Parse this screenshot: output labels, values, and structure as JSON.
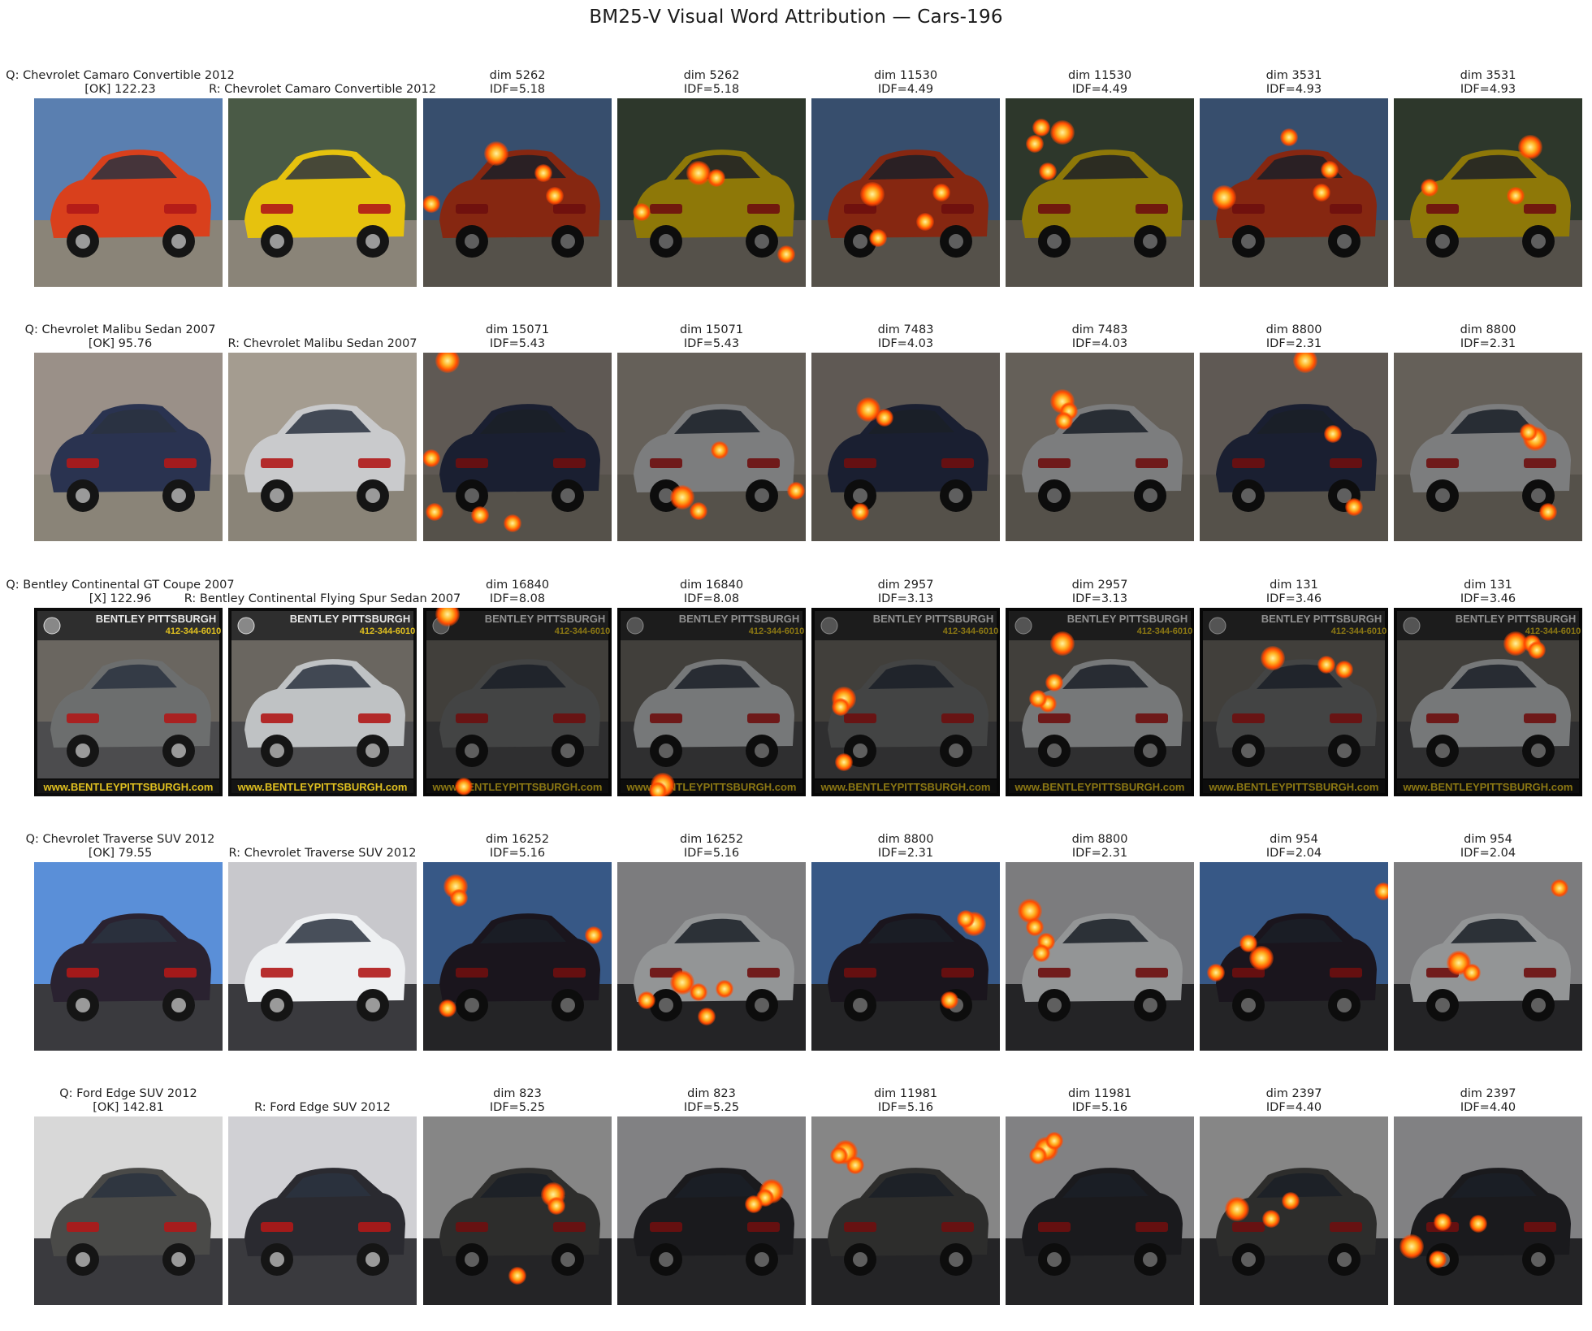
{
  "title": "BM25-V Visual Word Attribution — Cars-196",
  "rows": [
    {
      "query_label": "Q: Chevrolet Camaro Convertible 2012",
      "status": "[OK] 122.23",
      "retrieved_label": "R: Chevrolet Camaro Convertible 2012",
      "query_car_color": "#d9401c",
      "retrieved_car_color": "#e6c20e",
      "query_bg": "#5a7fb0",
      "retrieved_bg": "#4a5a46",
      "dims": [
        {
          "dim": "dim 5262",
          "idf": "IDF=5.18"
        },
        {
          "dim": "dim 5262",
          "idf": "IDF=5.18"
        },
        {
          "dim": "dim 11530",
          "idf": "IDF=4.49"
        },
        {
          "dim": "dim 11530",
          "idf": "IDF=4.49"
        },
        {
          "dim": "dim 3531",
          "idf": "IDF=4.93"
        },
        {
          "dim": "dim 3531",
          "idf": "IDF=4.93"
        }
      ]
    },
    {
      "query_label": "Q: Chevrolet Malibu Sedan 2007",
      "status": "[OK] 95.76",
      "retrieved_label": "R: Chevrolet Malibu Sedan 2007",
      "query_car_color": "#2a3350",
      "retrieved_car_color": "#c9cacc",
      "query_bg": "#9a9088",
      "retrieved_bg": "#a49c90",
      "dims": [
        {
          "dim": "dim 15071",
          "idf": "IDF=5.43"
        },
        {
          "dim": "dim 15071",
          "idf": "IDF=5.43"
        },
        {
          "dim": "dim 7483",
          "idf": "IDF=4.03"
        },
        {
          "dim": "dim 7483",
          "idf": "IDF=4.03"
        },
        {
          "dim": "dim 8800",
          "idf": "IDF=2.31"
        },
        {
          "dim": "dim 8800",
          "idf": "IDF=2.31"
        }
      ]
    },
    {
      "query_label": "Q: Bentley Continental GT Coupe 2007",
      "status": "[X] 122.96",
      "retrieved_label": "R: Bentley Continental Flying Spur Sedan 2007",
      "query_car_color": "#6c6e6e",
      "retrieved_car_color": "#bfc2c4",
      "query_bg": "#5e5a52",
      "retrieved_bg": "#5e5a52",
      "banner_text": "BENTLEY PITTSBURGH",
      "banner_phone": "412-344-6010",
      "banner_url": "www.BENTLEYPITTSBURGH.com",
      "dims": [
        {
          "dim": "dim 16840",
          "idf": "IDF=8.08"
        },
        {
          "dim": "dim 16840",
          "idf": "IDF=8.08"
        },
        {
          "dim": "dim 2957",
          "idf": "IDF=3.13"
        },
        {
          "dim": "dim 2957",
          "idf": "IDF=3.13"
        },
        {
          "dim": "dim 131",
          "idf": "IDF=3.46"
        },
        {
          "dim": "dim 131",
          "idf": "IDF=3.46"
        }
      ]
    },
    {
      "query_label": "Q: Chevrolet Traverse SUV 2012",
      "status": "[OK] 79.55",
      "retrieved_label": "R: Chevrolet Traverse SUV 2012",
      "query_car_color": "#2a2230",
      "retrieved_car_color": "#eef0f2",
      "query_bg": "#5a8fd8",
      "retrieved_bg": "#c8c8cc",
      "dims": [
        {
          "dim": "dim 16252",
          "idf": "IDF=5.16"
        },
        {
          "dim": "dim 16252",
          "idf": "IDF=5.16"
        },
        {
          "dim": "dim 8800",
          "idf": "IDF=2.31"
        },
        {
          "dim": "dim 8800",
          "idf": "IDF=2.31"
        },
        {
          "dim": "dim 954",
          "idf": "IDF=2.04"
        },
        {
          "dim": "dim 954",
          "idf": "IDF=2.04"
        }
      ]
    },
    {
      "query_label": "Q: Ford Edge SUV 2012",
      "status": "[OK] 142.81",
      "retrieved_label": "R: Ford Edge SUV 2012",
      "query_car_color": "#4a4a48",
      "retrieved_car_color": "#2a2a30",
      "query_bg": "#d8d8d8",
      "retrieved_bg": "#d0d0d4",
      "dims": [
        {
          "dim": "dim 823",
          "idf": "IDF=5.25"
        },
        {
          "dim": "dim 823",
          "idf": "IDF=5.25"
        },
        {
          "dim": "dim 11981",
          "idf": "IDF=5.16"
        },
        {
          "dim": "dim 11981",
          "idf": "IDF=5.16"
        },
        {
          "dim": "dim 2397",
          "idf": "IDF=4.40"
        },
        {
          "dim": "dim 2397",
          "idf": "IDF=4.40"
        }
      ]
    }
  ]
}
